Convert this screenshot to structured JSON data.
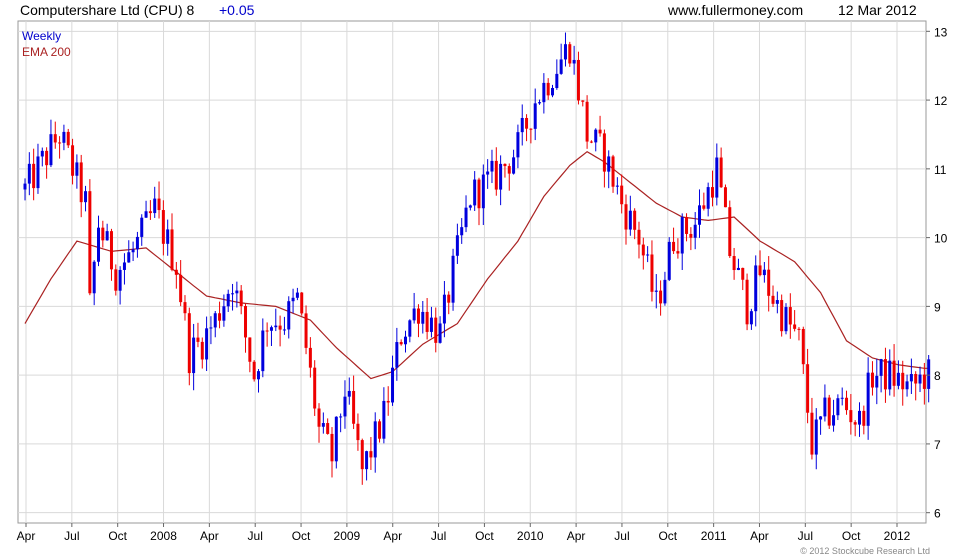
{
  "header": {
    "title": "Computershare Ltd (CPU) 8",
    "change": "+0.05",
    "site": "www.fullermoney.com",
    "date": "12 Mar 2012"
  },
  "legend": [
    {
      "label": "Weekly",
      "color": "#0000cc"
    },
    {
      "label": "EMA 200",
      "color": "#aa2222"
    }
  ],
  "copyright": "© 2012 Stockcube Research Ltd",
  "colors": {
    "up": "#0000dd",
    "down": "#ee0000",
    "ema": "#aa2222",
    "grid": "#d9d9d9"
  },
  "chart_data": {
    "type": "candlestick",
    "interval": "Weekly",
    "x_ticks": [
      "Apr",
      "Jul",
      "Oct",
      "2008",
      "Apr",
      "Jul",
      "Oct",
      "2009",
      "Apr",
      "Jul",
      "Oct",
      "2010",
      "Apr",
      "Jul",
      "Oct",
      "2011",
      "Apr",
      "Jul",
      "Oct",
      "2012"
    ],
    "y_ticks": [
      6,
      7,
      8,
      9,
      10,
      11,
      12,
      13
    ],
    "ylim": [
      5.85,
      13.15
    ],
    "grid": true,
    "price_keypoints": [
      [
        0,
        10.7
      ],
      [
        8,
        11.5
      ],
      [
        14,
        10.5
      ],
      [
        15,
        9.0
      ],
      [
        17,
        10.2
      ],
      [
        21,
        9.5
      ],
      [
        25,
        9.8
      ],
      [
        30,
        10.4
      ],
      [
        35,
        9.6
      ],
      [
        38,
        8.3
      ],
      [
        41,
        8.5
      ],
      [
        44,
        8.8
      ],
      [
        48,
        9.4
      ],
      [
        53,
        8.0
      ],
      [
        56,
        8.8
      ],
      [
        60,
        8.8
      ],
      [
        63,
        9.1
      ],
      [
        65,
        8.4
      ],
      [
        68,
        7.2
      ],
      [
        71,
        6.8
      ],
      [
        74,
        7.8
      ],
      [
        78,
        6.6
      ],
      [
        83,
        7.4
      ],
      [
        87,
        8.6
      ],
      [
        91,
        9.0
      ],
      [
        96,
        8.6
      ],
      [
        99,
        9.5
      ],
      [
        103,
        10.6
      ],
      [
        109,
        10.9
      ],
      [
        114,
        11.3
      ],
      [
        118,
        12.0
      ],
      [
        123,
        12.5
      ],
      [
        126,
        12.8
      ],
      [
        130,
        11.5
      ],
      [
        134,
        11.2
      ],
      [
        138,
        10.5
      ],
      [
        142,
        10.0
      ],
      [
        146,
        9.0
      ],
      [
        150,
        10.0
      ],
      [
        155,
        10.2
      ],
      [
        160,
        11.0
      ],
      [
        163,
        9.8
      ],
      [
        167,
        9.0
      ],
      [
        170,
        9.5
      ],
      [
        175,
        8.9
      ],
      [
        179,
        8.5
      ],
      [
        182,
        7.0
      ],
      [
        185,
        7.4
      ],
      [
        189,
        7.6
      ],
      [
        193,
        7.3
      ],
      [
        196,
        8.0
      ],
      [
        200,
        8.0
      ],
      [
        205,
        7.8
      ],
      [
        208,
        8.0
      ]
    ],
    "ema_keypoints": [
      [
        0,
        8.75
      ],
      [
        6,
        9.4
      ],
      [
        12,
        9.95
      ],
      [
        20,
        9.8
      ],
      [
        28,
        9.85
      ],
      [
        35,
        9.5
      ],
      [
        42,
        9.15
      ],
      [
        50,
        9.05
      ],
      [
        58,
        9.0
      ],
      [
        66,
        8.8
      ],
      [
        72,
        8.4
      ],
      [
        80,
        7.95
      ],
      [
        85,
        8.05
      ],
      [
        92,
        8.45
      ],
      [
        100,
        8.75
      ],
      [
        107,
        9.4
      ],
      [
        114,
        9.95
      ],
      [
        120,
        10.6
      ],
      [
        126,
        11.05
      ],
      [
        130,
        11.25
      ],
      [
        134,
        11.1
      ],
      [
        140,
        10.8
      ],
      [
        146,
        10.5
      ],
      [
        152,
        10.3
      ],
      [
        158,
        10.25
      ],
      [
        164,
        10.3
      ],
      [
        170,
        9.95
      ],
      [
        178,
        9.65
      ],
      [
        184,
        9.2
      ],
      [
        190,
        8.5
      ],
      [
        196,
        8.25
      ],
      [
        202,
        8.15
      ],
      [
        208,
        8.1
      ]
    ],
    "ema_end": 8.1
  }
}
